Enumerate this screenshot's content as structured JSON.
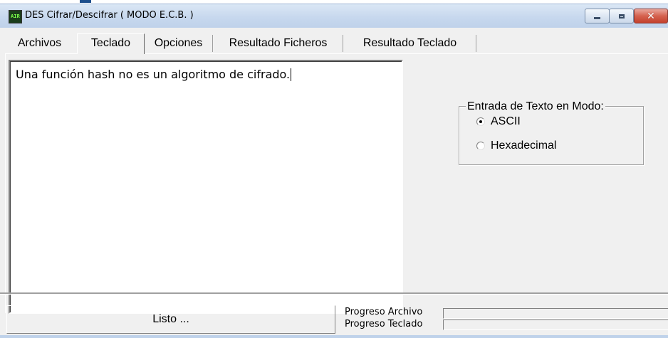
{
  "window": {
    "title": "DES Cifrar/Descifrar ( MODO E.C.B. )",
    "icon_text": "AIR"
  },
  "tabs": [
    {
      "label": "Archivos",
      "active": false
    },
    {
      "label": "Teclado",
      "active": true
    },
    {
      "label": "Opciones",
      "active": false
    },
    {
      "label": "Resultado Ficheros",
      "active": false
    },
    {
      "label": "Resultado Teclado",
      "active": false
    }
  ],
  "editor": {
    "text": "Una función hash no es un algoritmo de cifrado."
  },
  "input_mode": {
    "legend": "Entrada de Texto en Modo:",
    "options": [
      {
        "label": "ASCII",
        "checked": true
      },
      {
        "label": "Hexadecimal",
        "checked": false
      }
    ]
  },
  "status": {
    "message": "Listo ...",
    "progress_archivo_label": "Progreso Archivo",
    "progress_teclado_label": "Progreso Teclado",
    "progress_archivo_value": 0,
    "progress_teclado_value": 0
  },
  "colors": {
    "titlebar": "#c7d8ee",
    "close_button": "#c3412d",
    "client_bg": "#f0f0f0"
  }
}
